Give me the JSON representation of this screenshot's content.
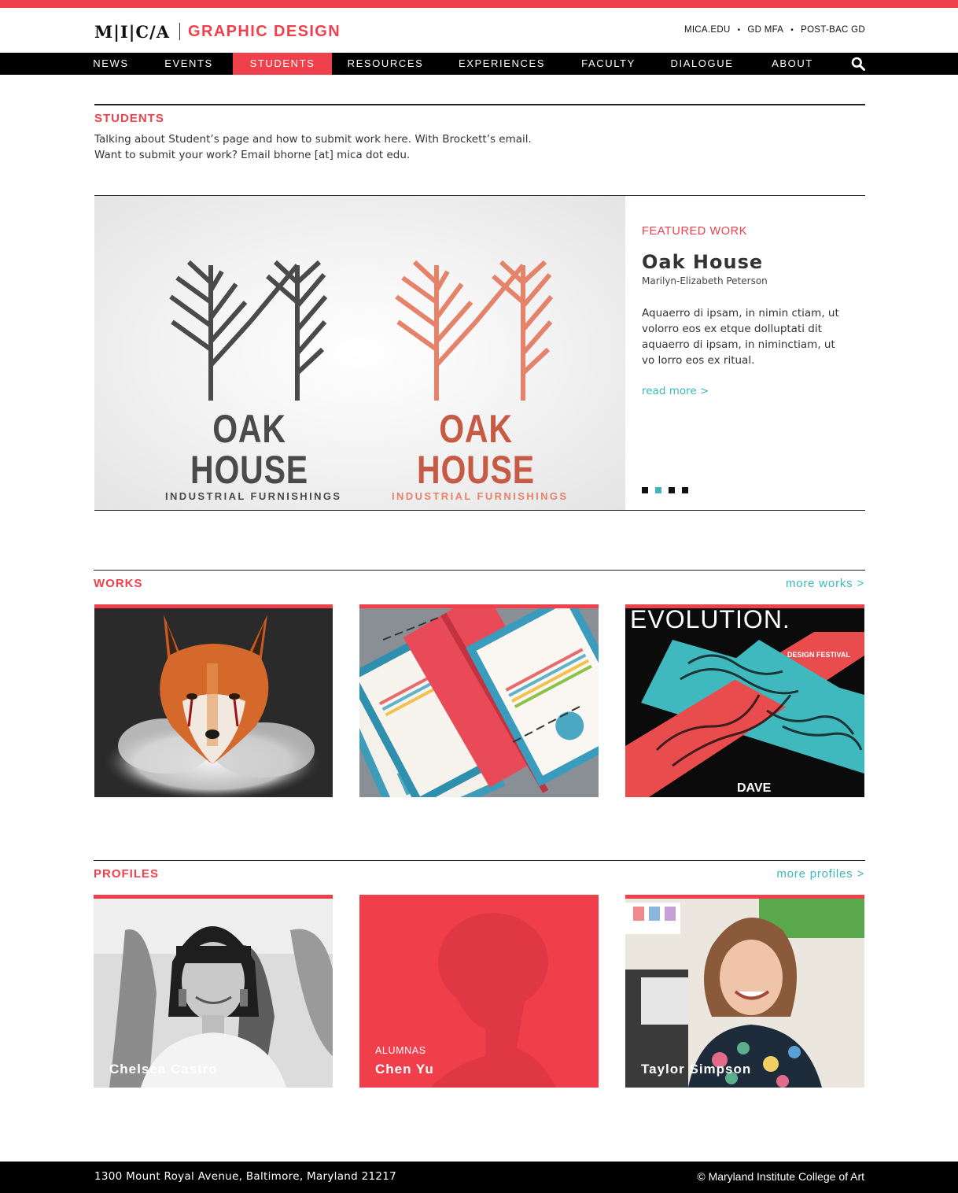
{
  "brand": {
    "logo": "M|I|C/A",
    "department": "GRAPHIC DESIGN",
    "accent_color": "#f0404c",
    "link_color": "#3bb7bd"
  },
  "top_links": [
    "MICA.EDU",
    "GD MFA",
    "POST-BAC GD"
  ],
  "nav": {
    "items": [
      "NEWS",
      "EVENTS",
      "STUDENTS",
      "RESOURCES",
      "EXPERIENCES",
      "FACULTY",
      "DIALOGUE",
      "ABOUT"
    ],
    "active": "STUDENTS",
    "search_icon": "search-icon"
  },
  "students": {
    "title": "STUDENTS",
    "line1": "Talking about Student’s page and how to submit work here. With Brockett’s email.",
    "line2": "Want to submit your work? Email bhorne [at] mica dot edu."
  },
  "featured": {
    "label": "FEATURED WORK",
    "title": "Oak House",
    "author": "Marilyn-Elizabeth Peterson",
    "description": "Aquaerro di ipsam, in nimin ctiam, ut volorro eos ex etque dolluptati dit aquaerro di ipsam, in niminctiam, ut vo lorro eos ex ritual.",
    "read_more": "read more >",
    "slide_count": 4,
    "active_slide": 2,
    "artwork": {
      "logo_name": "OAK HOUSE",
      "logo_tagline": "INDUSTRIAL FURNISHINGS",
      "colors": [
        "#4a4a4a",
        "#e5826a"
      ]
    }
  },
  "works": {
    "title": "WORKS",
    "more": "more works >",
    "items": [
      {
        "name": "fox-artwork"
      },
      {
        "name": "notebooks-artwork"
      },
      {
        "name": "evolution-poster",
        "headline": "EVOLUTION.",
        "sub": "DESIGN FESTIVAL",
        "footer": "DAVE"
      }
    ]
  },
  "profiles": {
    "title": "PROFILES",
    "more": "more profiles >",
    "items": [
      {
        "name": "Chelsea Castro"
      },
      {
        "name": "Chen Yu",
        "role": "ALUMNAS"
      },
      {
        "name": "Taylor Simpson"
      }
    ]
  },
  "footer": {
    "address": "1300 Mount Royal Avenue, Baltimore, Maryland 21217",
    "copyright": "© Maryland Institute College of Art"
  }
}
